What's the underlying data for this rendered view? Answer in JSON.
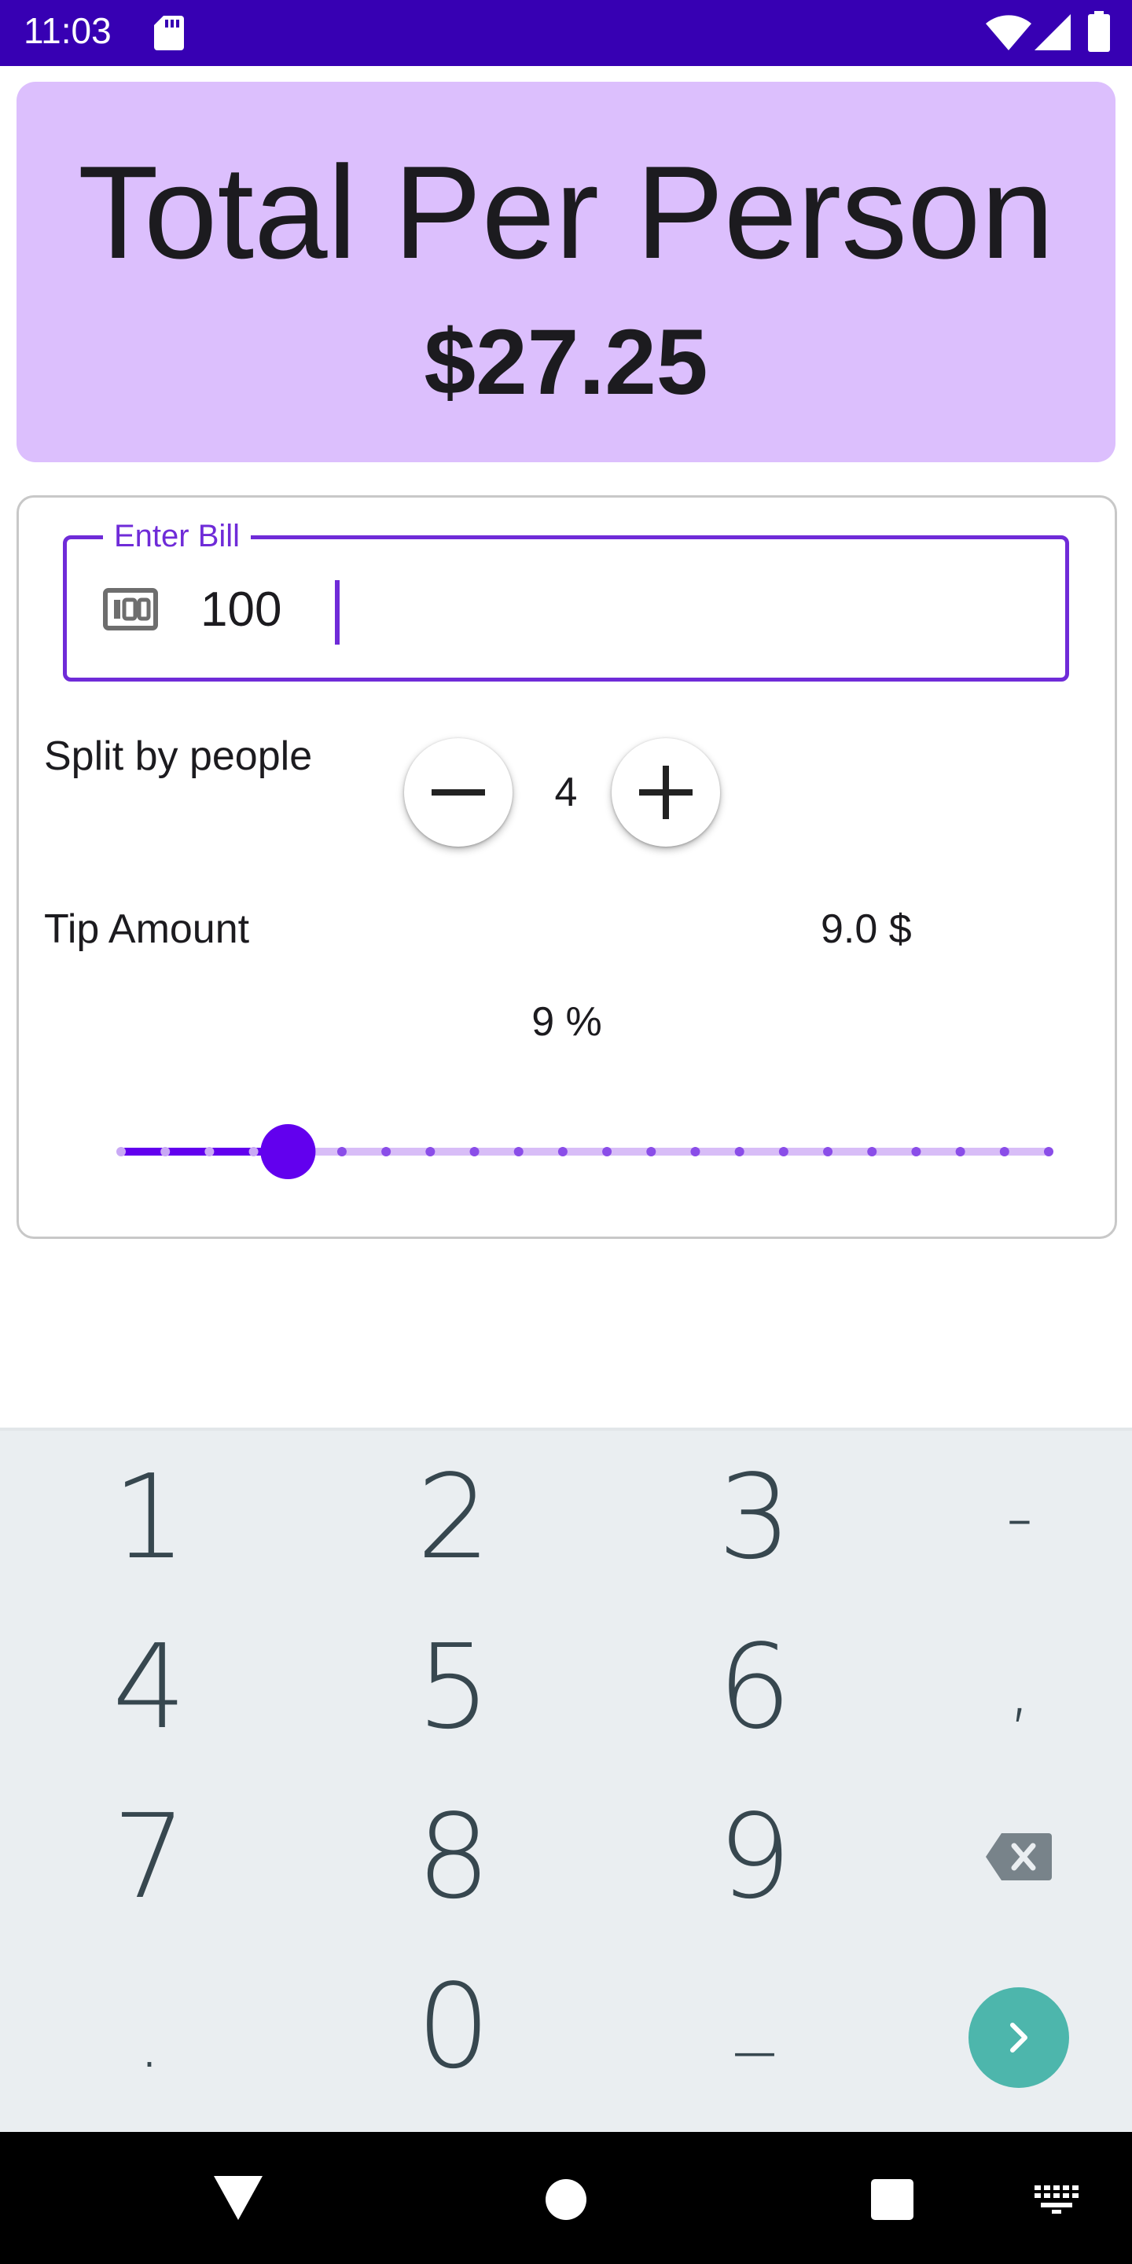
{
  "status_bar": {
    "time": "11:03",
    "icons": [
      "sd-card-icon",
      "wifi-icon",
      "signal-icon",
      "battery-icon"
    ]
  },
  "total": {
    "title": "Total Per Person",
    "amount": "$27.25"
  },
  "bill": {
    "label": "Enter Bill",
    "value": "100",
    "icon": "money-icon"
  },
  "split": {
    "label": "Split by people",
    "count": "4"
  },
  "tip": {
    "label": "Tip Amount",
    "amount": "9.0 $",
    "percent_label": "9 %",
    "slider_value_fraction": 0.09,
    "slider_steps": 22
  },
  "keyboard": {
    "rows": [
      [
        "1",
        "2",
        "3",
        "-"
      ],
      [
        "4",
        "5",
        "6",
        ","
      ],
      [
        "7",
        "8",
        "9",
        "backspace"
      ],
      [
        ".",
        "0",
        "_",
        "go"
      ]
    ],
    "keys": {
      "k1": "1",
      "k2": "2",
      "k3": "3",
      "dash": "-",
      "k4": "4",
      "k5": "5",
      "k6": "6",
      "comma": ",",
      "k7": "7",
      "k8": "8",
      "k9": "9",
      "period": ".",
      "k0": "0",
      "underscore": "_"
    }
  },
  "nav_bar": {
    "icons": [
      "back-icon",
      "home-icon",
      "recents-icon",
      "keyboard-switch-icon"
    ]
  },
  "colors": {
    "status_bar": "#3700b3",
    "accent": "#6200ee",
    "field_border": "#6f2bd8",
    "header_card": "#dcbffd",
    "keyboard_bg": "#eaeef1",
    "go_key": "#4db6ac"
  }
}
